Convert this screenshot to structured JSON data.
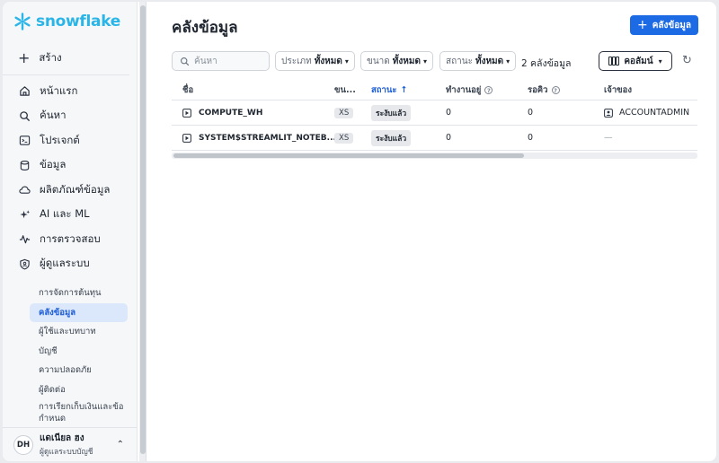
{
  "brand": {
    "name": "snowflake",
    "color": "#29b5e8"
  },
  "sidebar": {
    "create_label": "สร้าง",
    "items": [
      {
        "label": "หน้าแรก",
        "icon": "home-icon"
      },
      {
        "label": "ค้นหา",
        "icon": "search-icon"
      },
      {
        "label": "โปรเจกต์",
        "icon": "terminal-icon"
      },
      {
        "label": "ข้อมูล",
        "icon": "database-icon"
      },
      {
        "label": "ผลิตภัณฑ์ข้อมูล",
        "icon": "cloud-icon"
      },
      {
        "label": "AI และ ML",
        "icon": "sparkle-icon"
      },
      {
        "label": "การตรวจสอบ",
        "icon": "activity-icon"
      },
      {
        "label": "ผู้ดูแลระบบ",
        "icon": "shield-icon"
      }
    ],
    "sub_items": [
      {
        "label": "การจัดการต้นทุน"
      },
      {
        "label": "คลังข้อมูล"
      },
      {
        "label": "ผู้ใช้และบทบาท"
      },
      {
        "label": "บัญชี"
      },
      {
        "label": "ความปลอดภัย"
      },
      {
        "label": "ผู้ติดต่อ"
      },
      {
        "label": "การเรียกเก็บเงินและข้อกำหนด"
      }
    ],
    "user": {
      "initials": "DH",
      "name": "แดเนียล ฮง",
      "role": "ผู้ดูแลระบบบัญชี"
    }
  },
  "main": {
    "title": "คลังข้อมูล",
    "primary_button": "คลังข้อมูล",
    "search_placeholder": "ค้นหา",
    "filters": [
      {
        "label": "ประเภท",
        "value": "ทั้งหมด"
      },
      {
        "label": "ขนาด",
        "value": "ทั้งหมด"
      },
      {
        "label": "สถานะ",
        "value": "ทั้งหมด"
      }
    ],
    "count_text": "2 คลังข้อมูล",
    "columns_button": "คอลัมน์",
    "table": {
      "headers": {
        "name": "ชื่อ",
        "size": "ขน...",
        "status": "สถานะ",
        "running": "ทำงานอยู่",
        "queued": "รอคิว",
        "owner": "เจ้าของ"
      },
      "rows": [
        {
          "name": "COMPUTE_WH",
          "size": "XS",
          "status": "ระงับแล้ว",
          "running": "0",
          "queued": "0",
          "owner": "ACCOUNTADMIN"
        },
        {
          "name": "SYSTEM$STREAMLIT_NOTEB...",
          "size": "XS",
          "status": "ระงับแล้ว",
          "running": "0",
          "queued": "0",
          "owner": "—"
        }
      ]
    }
  },
  "colors": {
    "accent": "#1d6ae5",
    "active_nav_bg": "#dbe7fb"
  }
}
